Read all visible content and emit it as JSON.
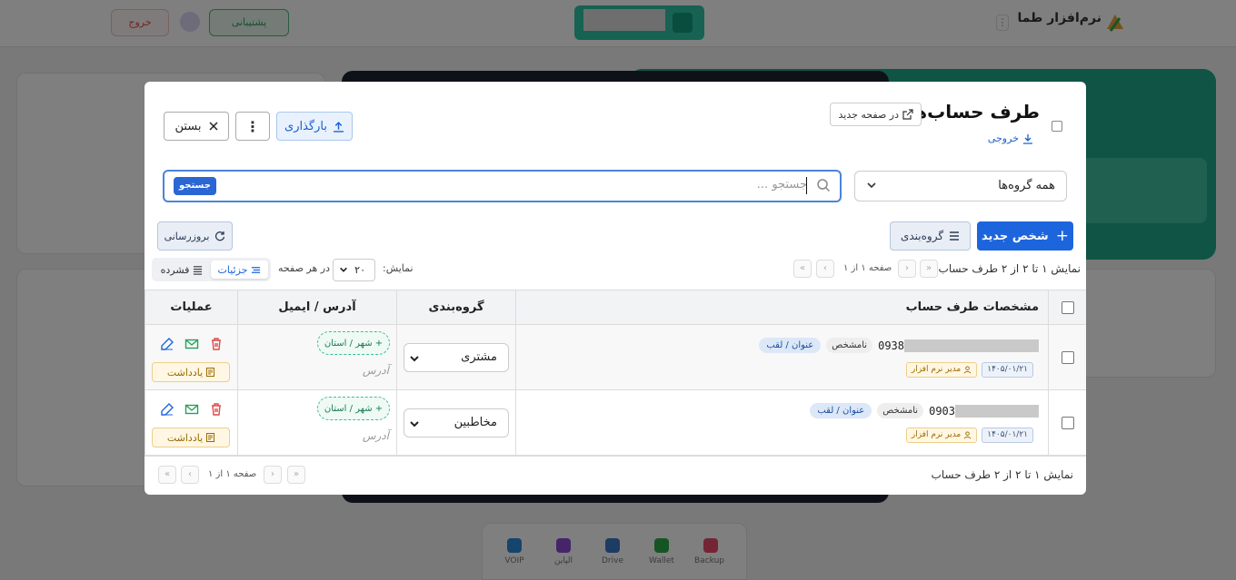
{
  "background": {
    "brand": "نرم‌افزار طما",
    "help_label": "پشتیبانی",
    "exit_label": "خروج",
    "dock": [
      {
        "label": "Backup",
        "color": "#e84a6a"
      },
      {
        "label": "Wallet",
        "color": "#2ea84a"
      },
      {
        "label": "Drive",
        "color": "#3a78c8"
      },
      {
        "label": "الپاین",
        "color": "#8a4ad0"
      },
      {
        "label": "VOIP",
        "color": "#2a88d8"
      }
    ]
  },
  "modal": {
    "title": "طرف حساب‌ها",
    "open_new_page": "در صفحه جدید",
    "export": "خروجی",
    "upload": "بارگذاری",
    "close": "بستن",
    "group_filter": "همه گروه‌ها",
    "search_placeholder": "جستجو ...",
    "search_button": "جستجو",
    "new_person": "شخص جدید",
    "grouping": "گروه‌بندی",
    "refresh": "بروزرسانی",
    "pager": {
      "summary": "نمایش ۱ تا ۲ از ۲ طرف حساب",
      "page_text": "صفحه ۱ از ۱",
      "show_label": "نمایش:",
      "per_page_value": "۲۰",
      "per_page_suffix": "در هر صفحه"
    },
    "view_toggle": {
      "details": "جزئیات",
      "compact": "فشرده"
    },
    "columns": {
      "spec": "مشخصات طرف حساب",
      "group": "گروه‌بندی",
      "address": "آدرس / ایمیل",
      "ops": "عملیات"
    },
    "rows": [
      {
        "phone": "0938",
        "unknown_label": "نامشخص",
        "title_chip": "عنوان / لقب",
        "date": "۱۴۰۵/۰۱/۲۱",
        "created_by": "مدیر نرم افزار",
        "group": "مشتری",
        "city_chip": "+ شهر / استان",
        "address_placeholder": "آدرس",
        "note": "یادداشت"
      },
      {
        "phone": "0903",
        "unknown_label": "نامشخص",
        "title_chip": "عنوان / لقب",
        "date": "۱۴۰۵/۰۱/۲۱",
        "created_by": "مدیر نرم افزار",
        "group": "مخاطبین",
        "city_chip": "+ شهر / استان",
        "address_placeholder": "آدرس",
        "note": "یادداشت"
      }
    ],
    "footer": {
      "summary": "نمایش ۱ تا ۲ از ۲ طرف حساب",
      "page_text": "صفحه ۱ از ۱"
    }
  },
  "colors": {
    "primary": "#1d65dc",
    "teal": "#1ea889",
    "danger": "#e04a4a",
    "success": "#28a05a",
    "note": "#9a6b00"
  }
}
